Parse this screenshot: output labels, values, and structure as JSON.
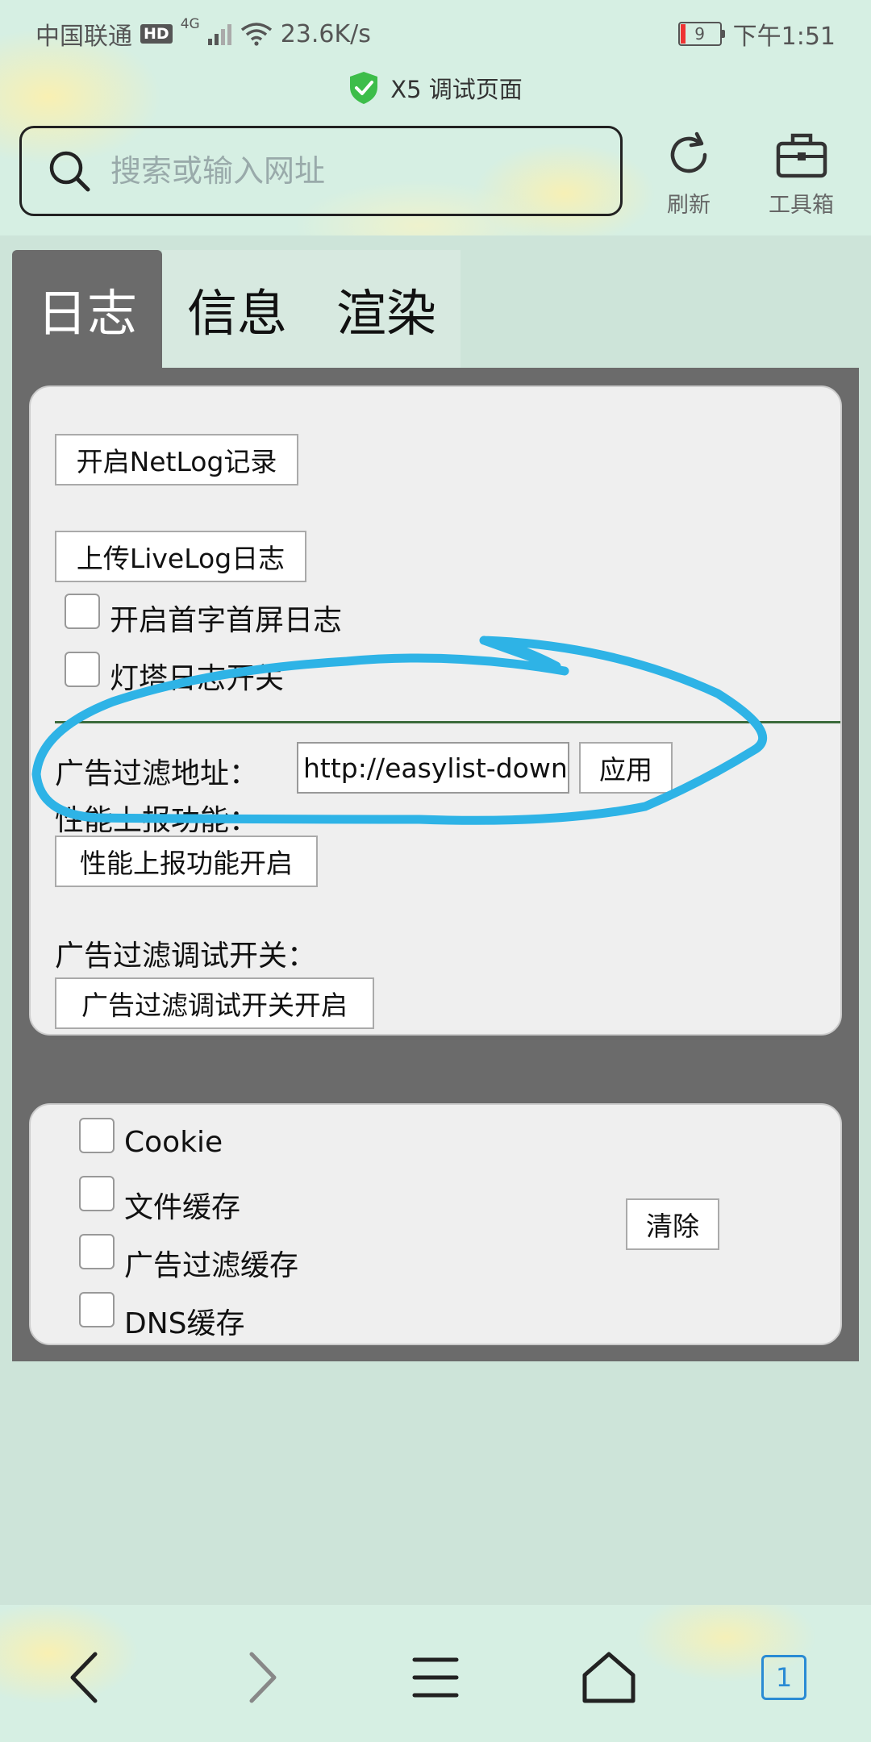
{
  "status_bar": {
    "carrier": "中国联通",
    "hd": "HD",
    "network": "4G",
    "speed": "23.6K/s",
    "battery": "9",
    "time": "下午1:51"
  },
  "page": {
    "title": "X5 调试页面"
  },
  "search": {
    "placeholder": "搜索或输入网址"
  },
  "toolbar": {
    "refresh_label": "刷新",
    "toolbox_label": "工具箱"
  },
  "tabs": [
    {
      "label": "日志",
      "active": true
    },
    {
      "label": "信息",
      "active": false
    },
    {
      "label": "渲染",
      "active": false
    }
  ],
  "log_panel": {
    "netlog_button": "开启NetLog记录",
    "upload_livelog_button": "上传LiveLog日志",
    "first_screen_log": "开启首字首屏日志",
    "lighthouse_log": "灯塔日志开关",
    "adfilter_url_label": "广告过滤地址：",
    "adfilter_url_value": "http://easylist-downloads.adblockplus.org/easylistchina.txt",
    "apply_button": "应用",
    "perf_report_label": "性能上报功能：",
    "perf_report_button": "性能上报功能开启",
    "adfilter_debug_label": "广告过滤调试开关：",
    "adfilter_debug_button": "广告过滤调试开关开启"
  },
  "cache_panel": {
    "items": [
      {
        "label": "Cookie"
      },
      {
        "label": "文件缓存"
      },
      {
        "label": "广告过滤缓存"
      },
      {
        "label": "DNS缓存"
      }
    ],
    "clear_button": "清除"
  },
  "bottom_nav": {
    "tab_count": "1"
  },
  "colors": {
    "panel_gray": "#6b6b6b",
    "card_bg": "#efefef",
    "annotation_blue": "#2eb3e6",
    "tab_count_blue": "#2a8bd4",
    "shield_green": "#3dbd4a"
  }
}
